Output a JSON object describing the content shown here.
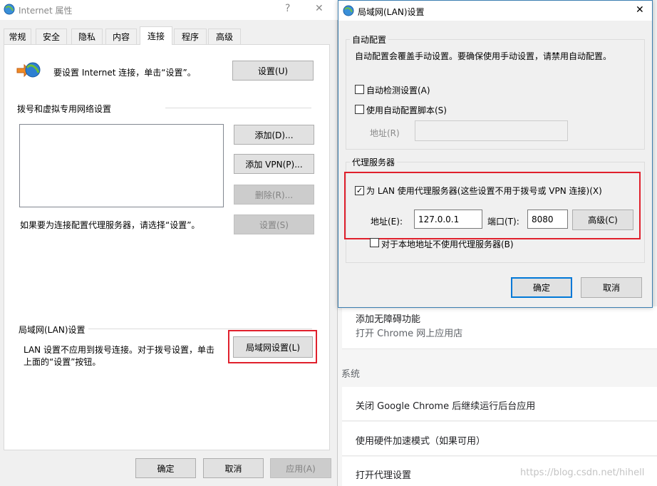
{
  "left_dialog": {
    "title": "Internet 属性",
    "help_glyph": "?",
    "close_glyph": "✕",
    "tabs": [
      "常规",
      "安全",
      "隐私",
      "内容",
      "连接",
      "程序",
      "高级"
    ],
    "active_tab": "连接",
    "setup_text": "要设置 Internet 连接，单击“设置”。",
    "setup_button": "设置(U)",
    "dialup_heading": "拨号和虚拟专用网络设置",
    "add_button": "添加(D)...",
    "add_vpn_button": "添加 VPN(P)...",
    "remove_button": "删除(R)...",
    "proxy_text": "如果要为连接配置代理服务器，请选择“设置”。",
    "settings_button": "设置(S)",
    "lan_heading": "局域网(LAN)设置",
    "lan_text_line1": "LAN 设置不应用到拨号连接。对于拨号设置，单击",
    "lan_text_line2": "上面的“设置”按钮。",
    "lan_button": "局域网设置(L)",
    "ok_button": "确定",
    "cancel_button": "取消",
    "apply_button": "应用(A)"
  },
  "lan_dialog": {
    "title": "局域网(LAN)设置",
    "close_glyph": "✕",
    "auto_group": "自动配置",
    "auto_desc": "自动配置会覆盖手动设置。要确保使用手动设置，请禁用自动配置。",
    "auto_detect": "自动检测设置(A)",
    "auto_script": "使用自动配置脚本(S)",
    "address_label": "地址(R)",
    "proxy_group": "代理服务器",
    "use_proxy": "为 LAN 使用代理服务器(这些设置不用于拨号或 VPN 连接)(X)",
    "use_proxy_checked": true,
    "check_glyph": "✓",
    "proxy_address_label": "地址(E):",
    "proxy_address_value": "127.0.0.1",
    "port_label": "端口(T):",
    "port_value": "8080",
    "advanced_button": "高级(C)",
    "bypass_local": "对于本地地址不使用代理服务器(B)",
    "ok_button": "确定",
    "cancel_button": "取消"
  },
  "chrome_bg": {
    "item_a11y": "添加无障碍功能",
    "item_webstore": "打开 Chrome 网上应用店",
    "section_system": "系统",
    "item_background": "关闭 Google Chrome 后继续运行后台应用",
    "item_hw_accel": "使用硬件加速模式（如果可用）",
    "item_proxy": "打开代理设置"
  },
  "watermark": "https://blog.csdn.net/hihell",
  "colors": {
    "highlight_red": "#e0202c",
    "focus_blue": "#0078d7"
  }
}
